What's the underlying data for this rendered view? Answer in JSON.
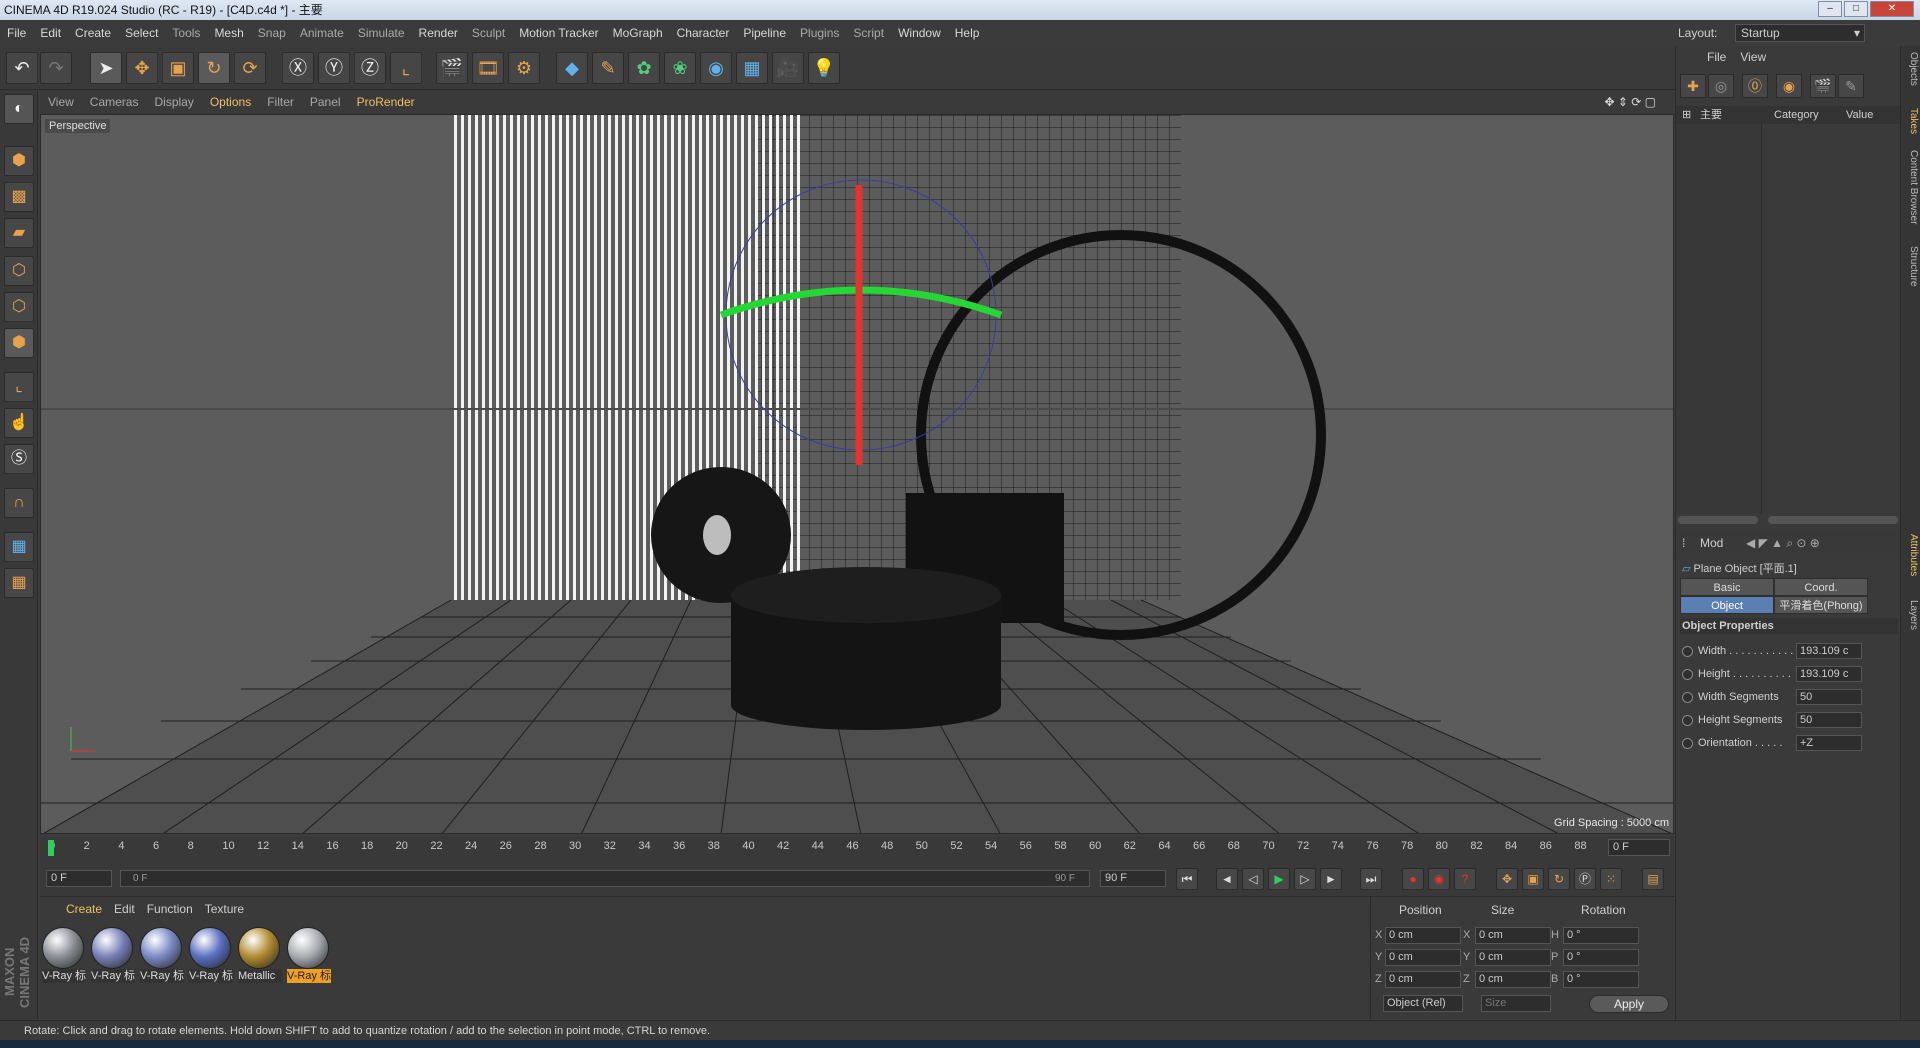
{
  "window": {
    "title": "CINEMA 4D R19.024 Studio (RC - R19) - [C4D.c4d *] - 主要"
  },
  "menu": [
    "File",
    "Edit",
    "Create",
    "Select",
    "Tools",
    "Mesh",
    "Snap",
    "Animate",
    "Simulate",
    "Render",
    "Sculpt",
    "Motion Tracker",
    "MoGraph",
    "Character",
    "Pipeline",
    "Plugins",
    "Script",
    "Window",
    "Help"
  ],
  "layout": {
    "label": "Layout:",
    "value": "Startup"
  },
  "viewport": {
    "menu": [
      "View",
      "Cameras",
      "Display",
      "Options",
      "Filter",
      "Panel",
      "ProRender"
    ],
    "camera_label": "Perspective",
    "grid_spacing": "Grid Spacing : 5000 cm"
  },
  "timeline": {
    "ticks": [
      "0",
      "2",
      "4",
      "6",
      "8",
      "10",
      "12",
      "14",
      "16",
      "18",
      "20",
      "22",
      "24",
      "26",
      "28",
      "30",
      "32",
      "34",
      "36",
      "38",
      "40",
      "42",
      "44",
      "46",
      "48",
      "50",
      "52",
      "54",
      "56",
      "58",
      "60",
      "62",
      "64",
      "66",
      "68",
      "70",
      "72",
      "74",
      "76",
      "78",
      "80",
      "82",
      "84",
      "86",
      "88",
      "90"
    ],
    "current_frame": "0 F",
    "start_frame": "0 F",
    "range_start": "0 F",
    "range_end": "90 F",
    "end_frame": "90 F"
  },
  "materials": {
    "menu": [
      "Create",
      "Edit",
      "Function",
      "Texture"
    ],
    "items": [
      {
        "name": "V-Ray 标",
        "color": "#8a8f96"
      },
      {
        "name": "V-Ray 标",
        "color": "#7780b8"
      },
      {
        "name": "V-Ray 标",
        "color": "#7a88c4"
      },
      {
        "name": "V-Ray 标",
        "color": "#5a6fc0"
      },
      {
        "name": "Metallic",
        "color": "#b08a30"
      },
      {
        "name": "V-Ray 标",
        "color": "#a8acb2"
      }
    ]
  },
  "coords": {
    "headers": [
      "Position",
      "Size",
      "Rotation"
    ],
    "rows": [
      {
        "pl": "X",
        "pv": "0 cm",
        "sl": "X",
        "sv": "0 cm",
        "rl": "H",
        "rv": "0 °"
      },
      {
        "pl": "Y",
        "pv": "0 cm",
        "sl": "Y",
        "sv": "0 cm",
        "rl": "P",
        "rv": "0 °"
      },
      {
        "pl": "Z",
        "pv": "0 cm",
        "sl": "Z",
        "sv": "0 cm",
        "rl": "B",
        "rv": "0 °"
      }
    ],
    "mode": "Object (Rel)",
    "size_mode": "Size",
    "apply": "Apply"
  },
  "object_manager": {
    "menu": [
      "File",
      "View"
    ],
    "root": "主要",
    "col_category": "Category",
    "col_value": "Value"
  },
  "attributes": {
    "mode_label": "Mod",
    "object_title": "Plane Object [平面.1]",
    "tabs_row1": [
      "Basic",
      "Coord."
    ],
    "tabs_row2": [
      "Object",
      "平滑着色(Phong)"
    ],
    "section": "Object Properties",
    "props": [
      {
        "label": "Width . . . . . . . . . . .",
        "value": "193.109 c"
      },
      {
        "label": "Height . . . . . . . . . .",
        "value": "193.109 c"
      },
      {
        "label": "Width Segments",
        "value": "50"
      },
      {
        "label": "Height Segments",
        "value": "50"
      },
      {
        "label": "Orientation . . . . .",
        "value": "+Z"
      }
    ]
  },
  "side_tabs": [
    "Objects",
    "Takes",
    "Content Browser",
    "Structure",
    "Attributes",
    "Layers"
  ],
  "status": "Rotate: Click and drag to rotate elements. Hold down SHIFT to add to quantize rotation / add to the selection in point mode, CTRL to remove.",
  "brand": "MAXON CINEMA 4D"
}
